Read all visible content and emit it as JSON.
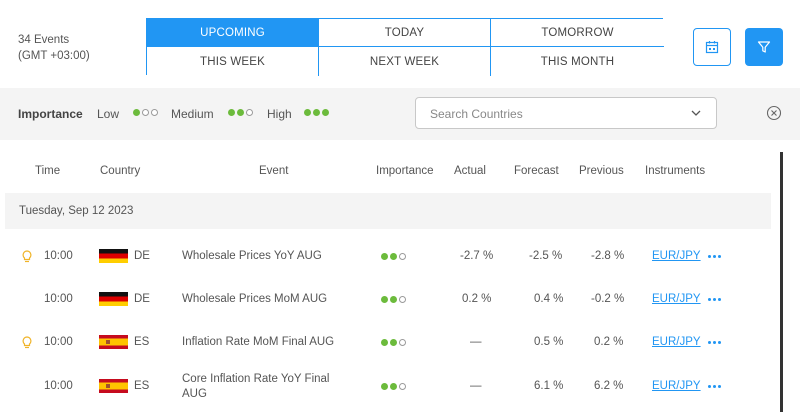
{
  "header": {
    "event_count": "34 Events",
    "timezone": "(GMT +03:00)",
    "periods": [
      {
        "label": "UPCOMING",
        "active": true
      },
      {
        "label": "TODAY",
        "active": false
      },
      {
        "label": "TOMORROW",
        "active": false
      },
      {
        "label": "THIS WEEK",
        "active": false
      },
      {
        "label": "NEXT WEEK",
        "active": false
      },
      {
        "label": "THIS MONTH",
        "active": false
      }
    ],
    "calendar_icon": "calendar-icon",
    "filter_icon": "filter-icon"
  },
  "filters": {
    "importance_label": "Importance",
    "levels": [
      {
        "label": "Low",
        "filled": 1
      },
      {
        "label": "Medium",
        "filled": 2
      },
      {
        "label": "High",
        "filled": 3
      }
    ],
    "search_placeholder": "Search Countries",
    "clear_icon": "close-circle-icon"
  },
  "table": {
    "columns": [
      "Time",
      "Country",
      "Event",
      "Importance",
      "Actual",
      "Forecast",
      "Previous",
      "Instruments"
    ],
    "day": "Tuesday, Sep 12 2023",
    "rows": [
      {
        "bulb": true,
        "time": "10:00",
        "country": "DE",
        "event": "Wholesale Prices YoY AUG",
        "event2": "",
        "importance": 2,
        "actual": "-2.7 %",
        "forecast": "-2.5 %",
        "previous": "-2.8 %",
        "instrument": "EUR/JPY"
      },
      {
        "bulb": false,
        "time": "10:00",
        "country": "DE",
        "event": "Wholesale Prices MoM AUG",
        "event2": "",
        "importance": 2,
        "actual": "0.2 %",
        "forecast": "0.4 %",
        "previous": "-0.2 %",
        "instrument": "EUR/JPY"
      },
      {
        "bulb": true,
        "time": "10:00",
        "country": "ES",
        "event": "Inflation Rate MoM Final AUG",
        "event2": "",
        "importance": 2,
        "actual": "—",
        "forecast": "0.5 %",
        "previous": "0.2 %",
        "instrument": "EUR/JPY"
      },
      {
        "bulb": false,
        "time": "10:00",
        "country": "ES",
        "event": "Core Inflation Rate YoY Final",
        "event2": "AUG",
        "importance": 2,
        "actual": "—",
        "forecast": "6.1 %",
        "previous": "6.2 %",
        "instrument": "EUR/JPY"
      }
    ]
  },
  "colors": {
    "accent": "#2196f3",
    "dot_green": "#6cbb3c",
    "bulb": "#f0b429"
  }
}
